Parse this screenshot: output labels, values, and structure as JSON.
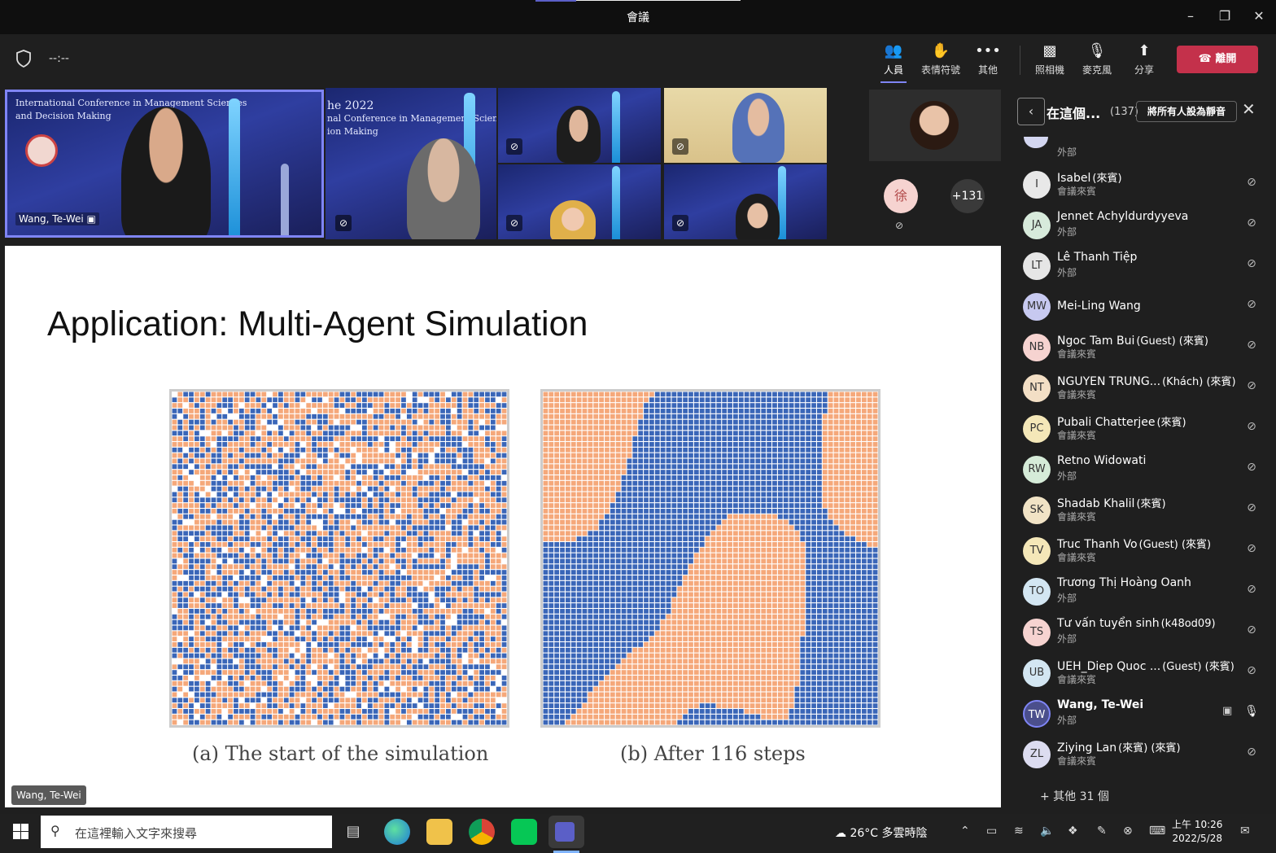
{
  "window": {
    "title": "會議",
    "timer": "--:--"
  },
  "toolbar": {
    "people": "人員",
    "reactions": "表情符號",
    "more": "其他",
    "camera": "照相機",
    "mic": "麥克風",
    "share": "分享",
    "leave": "離開"
  },
  "videos": {
    "main_name": "Wang, Te-Wei",
    "banner_lines": [
      "International Conference in Management Sciences",
      "and Decision Making"
    ],
    "banner_year": "he 2022",
    "banner_year_line": "nal Conference in Management Sciences",
    "banner_year_line2": "ion Making",
    "side_avatar_initial": "徐",
    "overflow_count": "+131"
  },
  "slide": {
    "title": "Application: Multi-Agent Simulation",
    "caption_a": "(a) The start of the simulation",
    "caption_b": "(b) After 116 steps",
    "presenter": "Wang, Te-Wei",
    "colors": {
      "blue": "#3a66b8",
      "orange": "#f5a87a"
    }
  },
  "panel": {
    "title": "在這個...",
    "count": "(137)",
    "mute_all": "將所有人設為靜音",
    "top_partial_sub": "外部",
    "participants": [
      {
        "initials": "I",
        "name": "Isabel",
        "tag": "(來賓)",
        "sub": "會議來賓",
        "color": "#e8e8e8"
      },
      {
        "initials": "JA",
        "name": "Jennet Achyldurdyyeva",
        "tag": "",
        "sub": "外部",
        "color": "#d7eadb"
      },
      {
        "initials": "LT",
        "name": "Lê Thanh Tiệp",
        "tag": "",
        "sub": "外部",
        "color": "#e6e6e6"
      },
      {
        "initials": "MW",
        "name": "Mei-Ling Wang",
        "tag": "",
        "sub": "",
        "color": "#c7c9f0"
      },
      {
        "initials": "NB",
        "name": "Ngoc Tam Bui",
        "tag": "(Guest) (來賓)",
        "sub": "會議來賓",
        "color": "#f6d3d0"
      },
      {
        "initials": "NT",
        "name": "NGUYEN TRUNG...",
        "tag": "(Khách) (來賓)",
        "sub": "會議來賓",
        "color": "#f3dfc5"
      },
      {
        "initials": "PC",
        "name": "Pubali Chatterjee",
        "tag": "(來賓)",
        "sub": "會議來賓",
        "color": "#f4e7b8"
      },
      {
        "initials": "RW",
        "name": "Retno Widowati",
        "tag": "",
        "sub": "外部",
        "color": "#d5ebd8"
      },
      {
        "initials": "SK",
        "name": "Shadab Khalil",
        "tag": "(來賓)",
        "sub": "會議來賓",
        "color": "#f1e3c5"
      },
      {
        "initials": "TV",
        "name": "Truc Thanh Vo",
        "tag": "(Guest) (來賓)",
        "sub": "會議來賓",
        "color": "#f4e7b8"
      },
      {
        "initials": "TO",
        "name": "Trương Thị Hoàng Oanh",
        "tag": "",
        "sub": "外部",
        "color": "#d3e6f2"
      },
      {
        "initials": "TS",
        "name": "Tư vấn tuyển sinh",
        "tag": "(k48od09)",
        "sub": "外部",
        "color": "#f6d3d0"
      },
      {
        "initials": "UB",
        "name": "UEH_Diep Quoc ...",
        "tag": "(Guest) (來賓)",
        "sub": "會議來賓",
        "color": "#d3e6f2"
      },
      {
        "initials": "TW",
        "name": "Wang, Te-Wei",
        "tag": "",
        "sub": "外部",
        "color": "#4b4f8c"
      },
      {
        "initials": "ZL",
        "name": "Ziying Lan",
        "tag": "(來賓) (來賓)",
        "sub": "會議來賓",
        "color": "#dcdcf0"
      }
    ],
    "more": "+ 其他 31 個"
  },
  "taskbar": {
    "search_placeholder": "在這裡輸入文字來搜尋",
    "weather": "26°C  多雲時陰",
    "time": "上午 10:26",
    "date": "2022/5/28"
  }
}
